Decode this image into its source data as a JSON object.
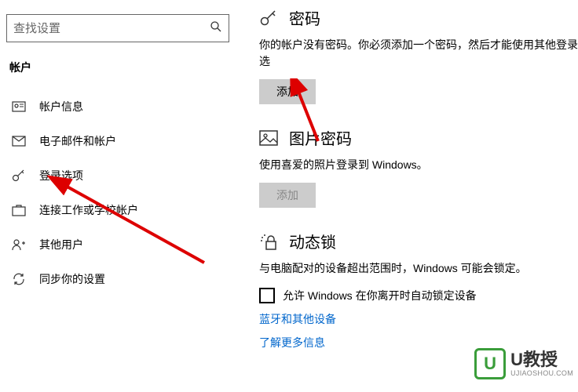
{
  "search": {
    "placeholder": "查找设置"
  },
  "section_title": "帐户",
  "sidebar": {
    "items": [
      {
        "label": "帐户信息"
      },
      {
        "label": "电子邮件和帐户"
      },
      {
        "label": "登录选项"
      },
      {
        "label": "连接工作或学校帐户"
      },
      {
        "label": "其他用户"
      },
      {
        "label": "同步你的设置"
      }
    ]
  },
  "password": {
    "title": "密码",
    "desc": "你的帐户没有密码。你必须添加一个密码，然后才能使用其他登录选",
    "button": "添加"
  },
  "picture_password": {
    "title": "图片密码",
    "desc": "使用喜爱的照片登录到 Windows。",
    "button": "添加"
  },
  "dynamic_lock": {
    "title": "动态锁",
    "desc": "与电脑配对的设备超出范围时，Windows 可能会锁定。",
    "checkbox_label": "允许 Windows 在你离开时自动锁定设备"
  },
  "links": {
    "bluetooth": "蓝牙和其他设备",
    "more": "了解更多信息"
  },
  "watermark": {
    "badge": "U",
    "main": "U教授",
    "sub": "UJIAOSHOU.COM"
  }
}
